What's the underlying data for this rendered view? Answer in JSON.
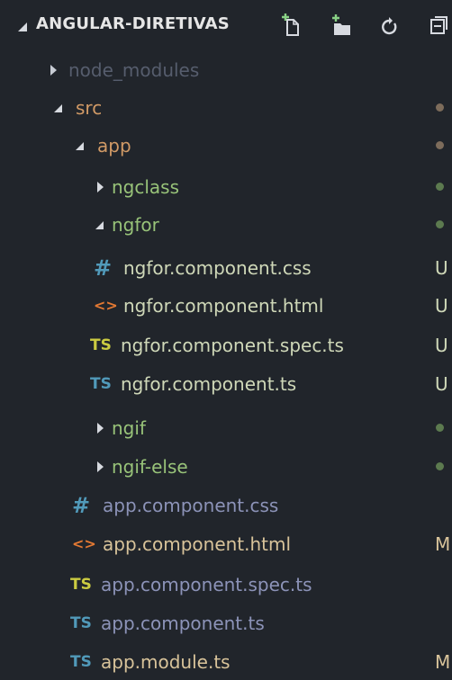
{
  "explorer": {
    "title": "ANGULAR-DIRETIVAS",
    "icons": [
      "new-file-icon",
      "new-folder-icon",
      "refresh-icon",
      "collapse-all-icon"
    ]
  },
  "colors": {
    "background": "#21252b",
    "text": "#d7dae0",
    "dimText": "#565d6d",
    "mutedText": "#8c93b8",
    "folderModified": "#d19a66",
    "folderUntracked": "#98c379",
    "dotModified": "#7d6c5b",
    "dotUntracked": "#5c7a4f",
    "statusModified": "#d8c39a",
    "statusUntracked": "#cfd8b8"
  },
  "tree": {
    "node_modules": {
      "label": "node_modules"
    },
    "src": {
      "label": "src"
    },
    "app": {
      "label": "app"
    },
    "ngclass": {
      "label": "ngclass"
    },
    "ngfor": {
      "label": "ngfor"
    },
    "ngfor_css": {
      "icon": "#",
      "label": "ngfor.component.css",
      "status": "U"
    },
    "ngfor_html": {
      "icon": "<>",
      "label": "ngfor.component.html",
      "status": "U"
    },
    "ngfor_spec": {
      "icon": "TS",
      "label": "ngfor.component.spec.ts",
      "status": "U"
    },
    "ngfor_ts": {
      "icon": "TS",
      "label": "ngfor.component.ts",
      "status": "U"
    },
    "ngif": {
      "label": "ngif"
    },
    "ngif_else": {
      "label": "ngif-else"
    },
    "app_css": {
      "icon": "#",
      "label": "app.component.css"
    },
    "app_html": {
      "icon": "<>",
      "label": "app.component.html",
      "status": "M"
    },
    "app_spec": {
      "icon": "TS",
      "label": "app.component.spec.ts"
    },
    "app_ts": {
      "icon": "TS",
      "label": "app.component.ts"
    },
    "app_module": {
      "icon": "TS",
      "label": "app.module.ts",
      "status": "M"
    }
  }
}
